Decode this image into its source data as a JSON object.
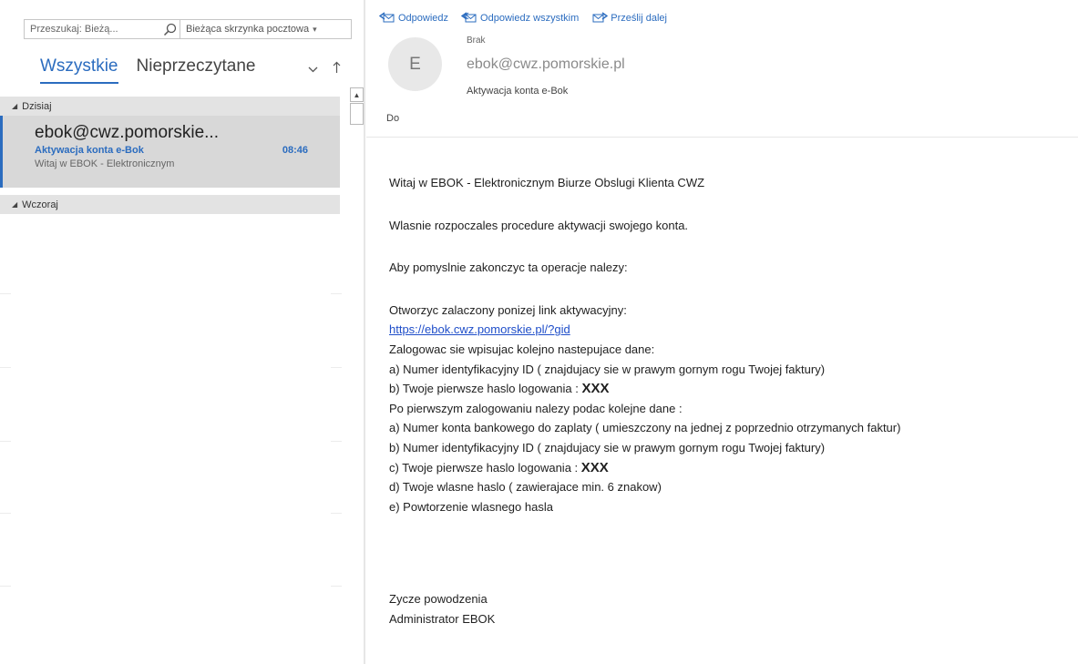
{
  "search": {
    "placeholder": "Przeszukaj: Bieżą...",
    "scope": "Bieżąca skrzynka pocztowa"
  },
  "filters": {
    "all": "Wszystkie",
    "unread": "Nieprzeczytane"
  },
  "groups": {
    "today": "Dzisiaj",
    "yesterday": "Wczoraj"
  },
  "message_list": [
    {
      "sender": "ebok@cwz.pomorskie...",
      "subject": "Aktywacja konta e-Bok",
      "time": "08:46",
      "preview": "Witaj w EBOK - Elektronicznym"
    }
  ],
  "reading_pane": {
    "actions": {
      "reply": "Odpowiedz",
      "reply_all": "Odpowiedz wszystkim",
      "forward": "Prześlij dalej"
    },
    "avatar_initial": "E",
    "label": "Brak",
    "from": "ebok@cwz.pomorskie.pl",
    "subject": "Aktywacja konta e-Bok",
    "to_label": "Do",
    "body": {
      "greeting": "Witaj w EBOK - Elektronicznym Biurze Obslugi Klienta CWZ",
      "p1": "Wlasnie rozpoczales procedure aktywacji swojego konta.",
      "p2": "Aby pomyslnie zakonczyc ta operacje nalezy:",
      "open_link": "Otworzyc zalaczony ponizej link aktywacyjny:",
      "link": "https://ebok.cwz.pomorskie.pl/?gid",
      "login": "Zalogowac sie wpisujac kolejno nastepujace dane:",
      "l_a": "a) Numer identyfikacyjny ID ( znajdujacy sie w prawym gornym rogu Twojej faktury)",
      "l_b": "b) Twoje pierwsze haslo logowania : ",
      "after_login": "Po pierwszym zalogowaniu nalezy podac kolejne dane :",
      "d_a": "a) Numer konta bankowego do zaplaty ( umieszczony na jednej z poprzednio otrzymanych faktur)",
      "d_b": "b) Numer identyfikacyjny ID ( znajdujacy sie w prawym gornym rogu Twojej faktury)",
      "d_c": "c) Twoje pierwsze haslo logowania : ",
      "d_d": "d) Twoje wlasne haslo ( zawierajace min. 6 znakow)",
      "d_e": "e) Powtorzenie wlasnego hasla",
      "password": "XXX",
      "closing": "Zycze powodzenia",
      "signature": "Administrator EBOK"
    }
  },
  "colors": {
    "accent": "#2b6cbf",
    "link": "#1f4ec9",
    "group_header_bg": "#e3e3e3",
    "selected_item_bg": "#d6d6d6"
  }
}
